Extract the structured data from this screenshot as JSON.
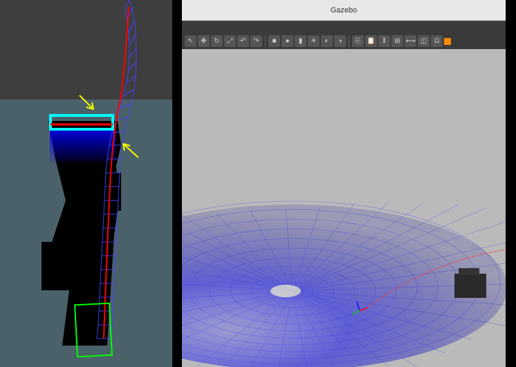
{
  "window": {
    "title": "Gazebo"
  },
  "toolbar": {
    "buttons": [
      {
        "icon": "cursor",
        "label": "↖"
      },
      {
        "icon": "move",
        "label": "✥"
      },
      {
        "icon": "rotate",
        "label": "↻"
      },
      {
        "icon": "scale",
        "label": "⤢"
      },
      {
        "icon": "undo",
        "label": "↶"
      },
      {
        "icon": "redo",
        "label": "↷"
      }
    ],
    "shapes": [
      {
        "icon": "box",
        "label": "■"
      },
      {
        "icon": "sphere",
        "label": "●"
      },
      {
        "icon": "cylinder",
        "label": "▮"
      },
      {
        "icon": "light1",
        "label": "☀"
      },
      {
        "icon": "light2",
        "label": "◐"
      },
      {
        "icon": "light3",
        "label": "◑"
      }
    ],
    "tools": [
      {
        "icon": "copy",
        "label": "⎘"
      },
      {
        "icon": "paste",
        "label": "📋"
      },
      {
        "icon": "align",
        "label": "⫴"
      },
      {
        "icon": "snap",
        "label": "⊞"
      },
      {
        "icon": "measure",
        "label": "⟷"
      },
      {
        "icon": "view",
        "label": "◫"
      },
      {
        "icon": "magnet",
        "label": "Ω"
      }
    ]
  },
  "left_viz": {
    "robot_highlight_color": "#00ffff",
    "path_color": "#ff0000",
    "grid_color": "#3333ff",
    "goal_color": "#00ff00",
    "arrow_color": "#ffff00",
    "costmap_dark": "#000000",
    "costmap_blue": "#0000ff"
  },
  "gazebo_scene": {
    "ground_color": "#bababa",
    "lidar_color": "#3a3aff",
    "path_color": "#ff3333",
    "vehicle_color": "#2a2a2a"
  }
}
